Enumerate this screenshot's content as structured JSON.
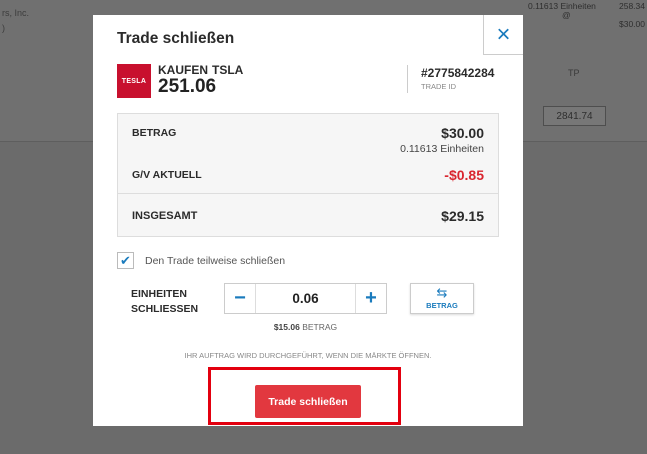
{
  "background": {
    "left_text": [
      "rs, Inc.",
      ")"
    ],
    "right_rows": [
      {
        "a": "0.11613 Einheiten",
        "b": "258.34"
      },
      {
        "a": "@",
        "b": ""
      },
      {
        "a": "",
        "b": "$30.00"
      }
    ],
    "tp_label": "TP",
    "tp_value": "2841.74"
  },
  "modal": {
    "title": "Trade schließen",
    "close_icon": "×"
  },
  "instrument": {
    "logo_text": "TESLA",
    "action": "KAUFEN",
    "symbol": "TSLA",
    "price": "251.06",
    "trade_id": "#2775842284",
    "trade_id_label": "TRADE ID"
  },
  "summary": {
    "amount_label": "BETRAG",
    "amount_value": "$30.00",
    "units_value": "0.11613 Einheiten",
    "pnl_label": "G/V AKTUELL",
    "pnl_value": "-$0.85",
    "total_label": "INSGESAMT",
    "total_value": "$29.15"
  },
  "partial_close": {
    "checked": true,
    "label": "Den Trade teilweise schließen"
  },
  "units": {
    "label_line1": "EINHEITEN",
    "label_line2": "SCHLIESSEN",
    "minus": "−",
    "value": "0.06",
    "plus": "+",
    "toggle_label": "BETRAG",
    "toggle_icon": "⇆",
    "amount_value": "$15.06",
    "amount_label": "BETRAG"
  },
  "market_note": "IHR AUFTRAG WIRD DURCHGEFÜHRT, WENN DIE MÄRKTE ÖFFNEN.",
  "submit_label": "Trade schließen",
  "colors": {
    "accent_blue": "#1a7bbd",
    "negative_red": "#d9262f",
    "button_red": "#e2383f",
    "highlight_red": "#e3000f"
  }
}
